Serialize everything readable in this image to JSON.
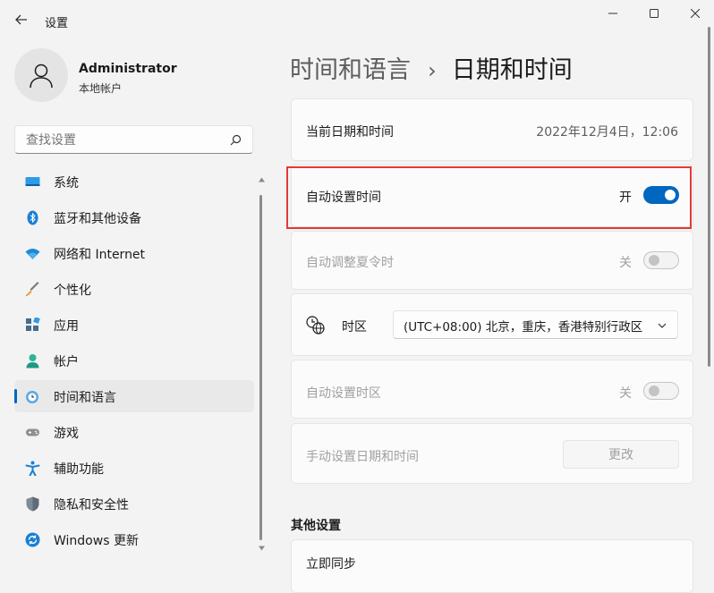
{
  "window": {
    "title": "设置",
    "back_icon": "arrow-left-icon",
    "minimize_icon": "minimize-icon",
    "maximize_icon": "maximize-icon",
    "close_icon": "close-icon"
  },
  "profile": {
    "name": "Administrator",
    "account_type": "本地帐户",
    "avatar_icon": "user-icon"
  },
  "search": {
    "placeholder": "查找设置",
    "icon": "search-icon"
  },
  "sidebar": {
    "items": [
      {
        "label": "系统",
        "icon": "system-display-icon"
      },
      {
        "label": "蓝牙和其他设备",
        "icon": "bluetooth-icon"
      },
      {
        "label": "网络和 Internet",
        "icon": "wifi-icon"
      },
      {
        "label": "个性化",
        "icon": "brush-icon"
      },
      {
        "label": "应用",
        "icon": "apps-icon"
      },
      {
        "label": "帐户",
        "icon": "account-icon"
      },
      {
        "label": "时间和语言",
        "icon": "time-language-icon",
        "selected": true
      },
      {
        "label": "游戏",
        "icon": "gamepad-icon"
      },
      {
        "label": "辅助功能",
        "icon": "accessibility-icon"
      },
      {
        "label": "隐私和安全性",
        "icon": "shield-icon"
      },
      {
        "label": "Windows 更新",
        "icon": "windows-update-icon"
      }
    ]
  },
  "breadcrumb": {
    "parent": "时间和语言",
    "separator": "›",
    "current": "日期和时间"
  },
  "content": {
    "current_datetime": {
      "label": "当前日期和时间",
      "value": "2022年12月4日，12:06"
    },
    "auto_time": {
      "label": "自动设置时间",
      "state_label": "开",
      "on": true
    },
    "auto_dst": {
      "label": "自动调整夏令时",
      "state_label": "关",
      "on": false,
      "disabled": true
    },
    "timezone": {
      "label": "时区",
      "icon": "globe-clock-icon",
      "selected": "(UTC+08:00) 北京，重庆，香港特别行政区",
      "dropdown_icon": "chevron-down-icon"
    },
    "auto_timezone": {
      "label": "自动设置时区",
      "state_label": "关",
      "on": false,
      "disabled": true
    },
    "manual_set": {
      "label": "手动设置日期和时间",
      "button_label": "更改",
      "disabled": true
    },
    "other_settings_title": "其他设置",
    "partial_next_label": "立即同步"
  },
  "colors": {
    "accent": "#0067c0",
    "highlight_box": "#e53935",
    "background": "#f3f3f3"
  }
}
